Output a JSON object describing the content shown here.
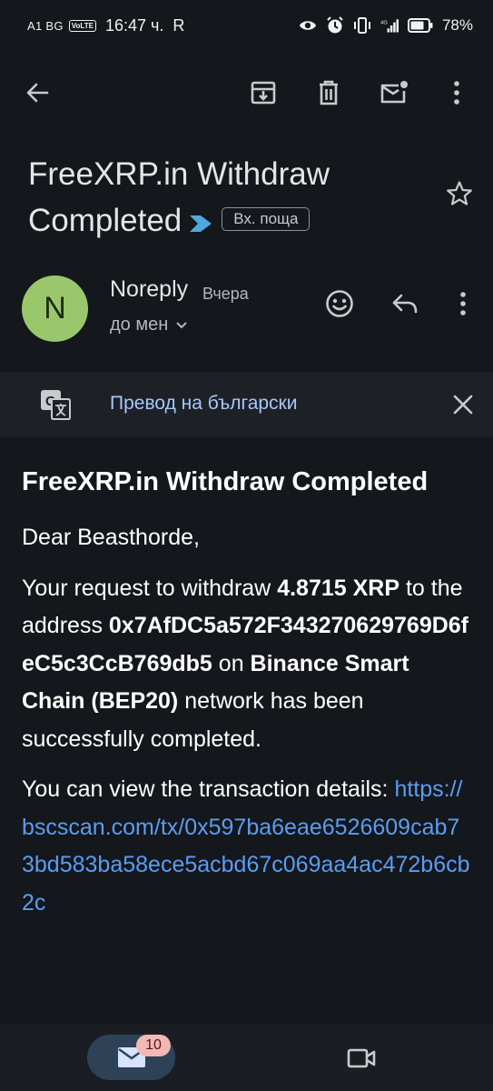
{
  "status_bar": {
    "carrier": "A1 BG",
    "volte": "VoLTE",
    "time": "16:47 ч.",
    "r_indicator": "R",
    "network": "4G",
    "battery": "78%"
  },
  "toolbar": {
    "icons": [
      "back-arrow-icon",
      "archive-icon",
      "delete-icon",
      "mark-unread-icon",
      "more-vert-icon"
    ]
  },
  "email": {
    "subject": "FreeXRP.in Withdraw Completed",
    "label": "Вх. поща",
    "sender_name": "Noreply",
    "sender_initial": "N",
    "time": "Вчера",
    "recipient": "до мен",
    "avatar_color": "#9ac76b"
  },
  "translate": {
    "text": "Превод на български"
  },
  "body": {
    "heading": "FreeXRP.in Withdraw Completed",
    "greeting": "Dear Beasthorde,",
    "p1_part1": "Your request to withdraw ",
    "amount": "4.8715 XRP",
    "p1_part2": " to the address ",
    "address": "0x7AfDC5a572F343270629769D6feC5c3CcB769db5",
    "p1_part3": " on ",
    "network": "Binance Smart Chain (BEP20)",
    "p1_part4": " network has been successfully completed.",
    "p2": "You can view the transaction details:",
    "link": "https://bscscan.com/tx/0x597ba6eae6526609cab73bd583ba58ece5acbd67c069aa4ac472b6cb2c"
  },
  "bottom_nav": {
    "mail_badge": "10"
  },
  "colors": {
    "background": "#14171b",
    "link": "#5b9cf2",
    "translate_text": "#a8c7fa",
    "importance_marker": "#4ea8de",
    "badge": "#f2b8b5"
  }
}
